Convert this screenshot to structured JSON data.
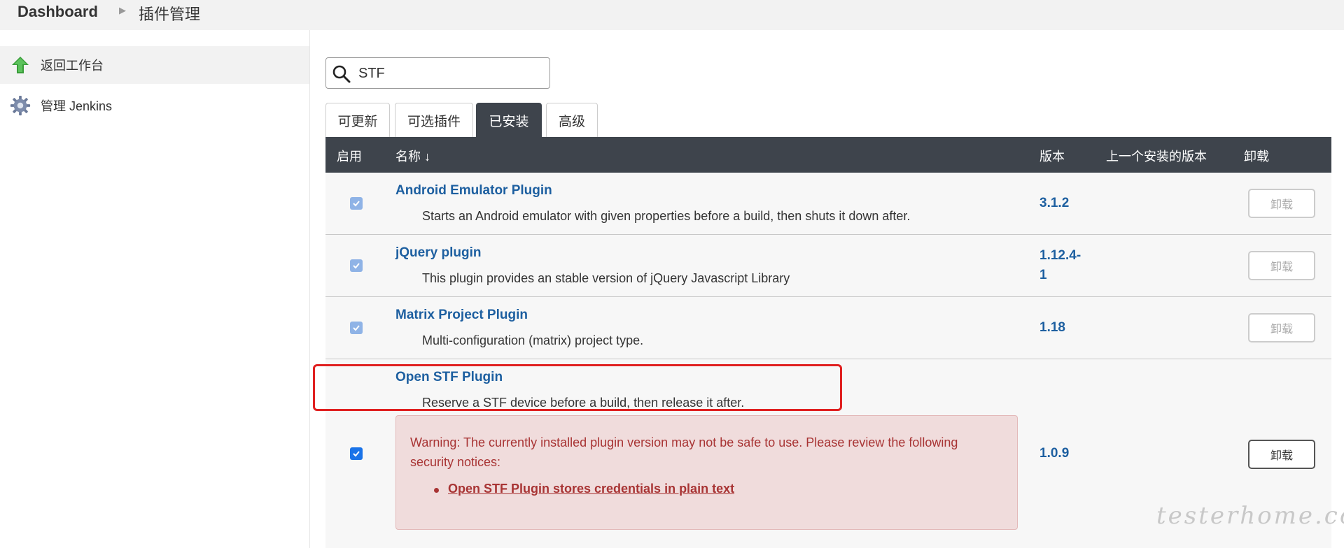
{
  "breadcrumb": {
    "home": "Dashboard",
    "current": "插件管理"
  },
  "sidebar": {
    "items": [
      {
        "label": "返回工作台",
        "icon": "up-arrow-icon"
      },
      {
        "label": "管理 Jenkins",
        "icon": "gear-icon"
      }
    ]
  },
  "search": {
    "value": "STF"
  },
  "tabs": [
    {
      "label": "可更新"
    },
    {
      "label": "可选插件"
    },
    {
      "label": "已安装",
      "active": true
    },
    {
      "label": "高级"
    }
  ],
  "table": {
    "headers": {
      "enabled": "启用",
      "name": "名称 ↓",
      "version": "版本",
      "previous": "上一个安装的版本",
      "uninstall": "卸载"
    },
    "rows": [
      {
        "name": "Android Emulator Plugin",
        "description": "Starts an Android emulator with given properties before a build, then shuts it down after.",
        "version": "3.1.2",
        "uninstall": "卸载",
        "enabled": true
      },
      {
        "name": "jQuery plugin",
        "description": "This plugin provides an stable version of jQuery Javascript Library",
        "version_line1": "1.12.4-",
        "version_line2": "1",
        "uninstall": "卸载",
        "enabled": true
      },
      {
        "name": "Matrix Project Plugin",
        "description": "Multi-configuration (matrix) project type.",
        "version": "1.18",
        "uninstall": "卸载",
        "enabled": true
      },
      {
        "name": "Open STF Plugin",
        "description": "Reserve a STF device before a build, then release it after.",
        "version": "1.0.9",
        "uninstall": "卸载",
        "enabled": true,
        "warning": {
          "text": "Warning: The currently installed plugin version may not be safe to use. Please review the following security notices:",
          "link": "Open STF Plugin stores credentials in plain text"
        }
      }
    ]
  },
  "colors": {
    "header_bg": "#3e444c",
    "link": "#1d5fa0",
    "warning_text": "#a83434",
    "warning_bg": "#f0dcdc",
    "highlight": "#e02020"
  },
  "watermark": "testerhome.com"
}
